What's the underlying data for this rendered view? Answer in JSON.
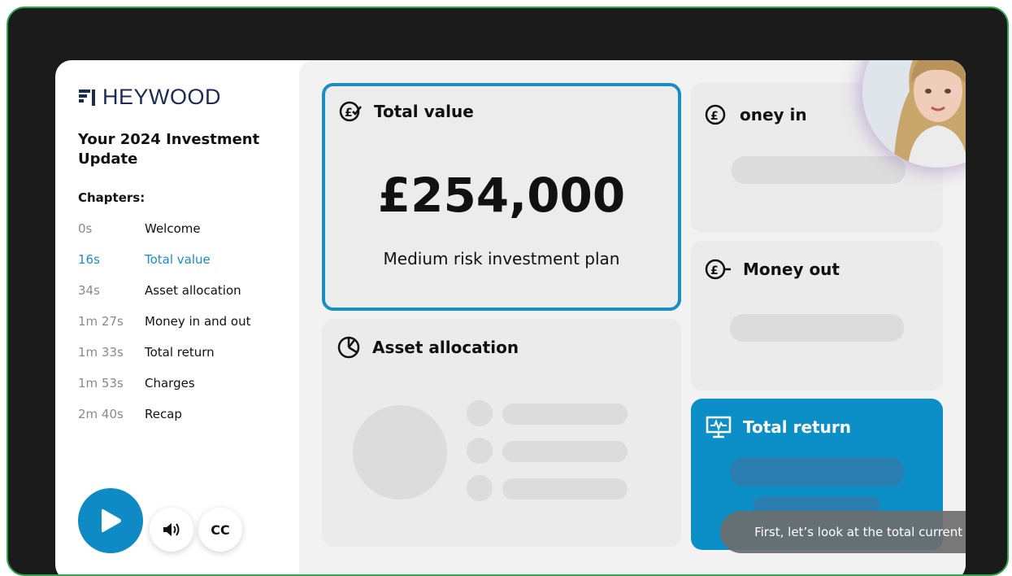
{
  "brand": {
    "logo_text": "HEYWOOD",
    "navy": "#1c2a54",
    "accent": "#0e8bc5"
  },
  "sidebar": {
    "title": "Your 2024 Investment Update",
    "chapters_label": "Chapters:",
    "chapters": [
      {
        "time": "0s",
        "name": "Welcome",
        "active": false
      },
      {
        "time": "16s",
        "name": "Total value",
        "active": true
      },
      {
        "time": "34s",
        "name": "Asset allocation",
        "active": false
      },
      {
        "time": "1m 27s",
        "name": "Money in and out",
        "active": false
      },
      {
        "time": "1m 33s",
        "name": "Total return",
        "active": false
      },
      {
        "time": "1m 53s",
        "name": "Charges",
        "active": false
      },
      {
        "time": "2m 40s",
        "name": "Recap",
        "active": false
      }
    ]
  },
  "controls": {
    "play_icon": "play-icon",
    "volume_icon": "volume-icon",
    "cc_label": "CC"
  },
  "cards": {
    "total_value": {
      "title": "Total value",
      "amount": "£254,000",
      "subtitle": "Medium risk investment plan",
      "icon": "pound-check-icon"
    },
    "money_in": {
      "title": "oney in",
      "icon": "pound-plus-icon"
    },
    "money_out": {
      "title": "Money out",
      "icon": "pound-minus-icon"
    },
    "asset_allocation": {
      "title": "Asset allocation",
      "icon": "pie-chart-icon"
    },
    "total_return": {
      "title": "Total return",
      "icon": "monitor-chart-icon"
    }
  },
  "caption": "First, let’s look at the total current value"
}
